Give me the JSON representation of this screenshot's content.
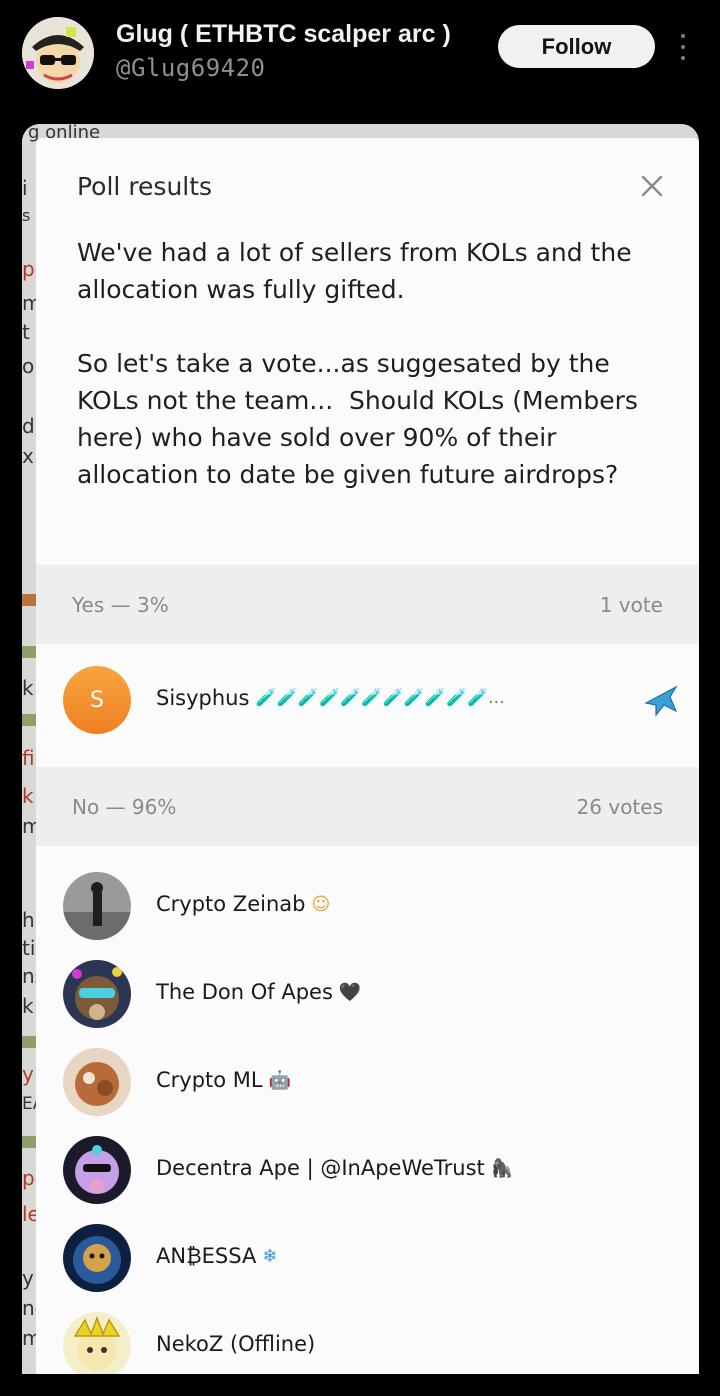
{
  "tweet": {
    "author_name": "Glug ( ETHBTC scalper arc )",
    "author_handle": "@Glug69420",
    "follow_label": "Follow"
  },
  "background_chat": {
    "fragments": [
      "g online",
      "i",
      "s",
      "pe",
      "m",
      "t",
      "ol",
      "d",
      "x",
      "k t",
      "fi",
      "k",
      "m",
      "h",
      "ti",
      "ns",
      "k",
      "y",
      "EA",
      "pe",
      "le",
      "y",
      "ne",
      "m"
    ]
  },
  "poll": {
    "title": "Poll results",
    "question": "We've had a lot of sellers from KOLs and the allocation was fully gifted.\n\nSo let's take a vote...as suggesated by the KOLs not the team...  Should KOLs (Members here) who have sold over 90% of their allocation to date be given future airdrops?",
    "options": [
      {
        "label": "Yes — 3%",
        "votes": "1 vote",
        "voters": [
          {
            "name": "Sisyphus",
            "suffix": "🧪🧪🧪🧪🧪🧪🧪🧪🧪🧪🧪...",
            "initial": "S"
          }
        ]
      },
      {
        "label": "No — 96%",
        "votes": "26 votes",
        "voters": [
          {
            "name": "Crypto Zeinab",
            "badge": "☺"
          },
          {
            "name": "The Don Of Apes",
            "badge": "🖤"
          },
          {
            "name": "Crypto ML",
            "badge": "🤖"
          },
          {
            "name": "Decentra Ape | @InApeWeTrust",
            "badge": "🦍"
          },
          {
            "name": "AN₿ESSA",
            "badge": "❄"
          },
          {
            "name": "NekoZ (Offline)",
            "badge": ""
          }
        ]
      }
    ]
  },
  "colors": {
    "follow_bg": "#eff1f3",
    "modal_bg": "#fbfbfb",
    "option_header_bg": "#eeeeee",
    "letter_avatar": "#f28a2a",
    "plane_icon": "#3aa0d8"
  }
}
